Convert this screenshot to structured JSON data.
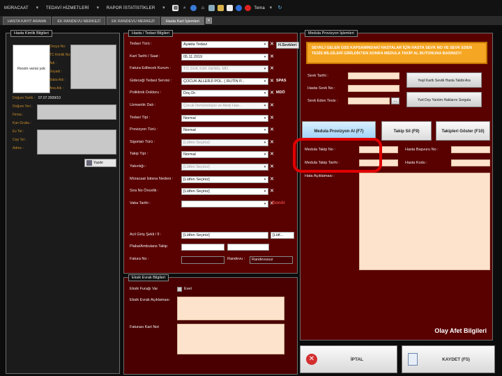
{
  "menu": {
    "items": [
      "MÜRACAAT",
      "TEDAVİ HİZMETLERİ",
      "RAPOR İSTATİSTİKLER"
    ],
    "tema_label": "Tema"
  },
  "tabs": [
    "HASTA KAYIT ARAMA",
    "EK RANDEVU MERKEZİ",
    "EK RANDEVU MERKEZİ",
    "Hasta Kart İşlemleri"
  ],
  "tab_close": "✕",
  "left": {
    "legend": "Hasta Kimlik Bilgileri",
    "photo_text": "Resim verisi yok",
    "labels_top": [
      "Dosya No:",
      "TC Kimlik No:",
      "Adı :",
      "Soyadı :",
      "Baba Adı :",
      "Ana Adı :"
    ],
    "dogum_label": "Doğum Tarihi :",
    "dogum_value": "07.07.2009/10",
    "labels_mid": [
      "Doğum Yeri :",
      "Firma :",
      "Kan Grubu :",
      "Ev Tel :",
      "Cep Tel :",
      "Adres :"
    ],
    "yazdir": "Yazdır"
  },
  "mid": {
    "legend": "Hasta / Tedavi Bilgileri",
    "rows": [
      {
        "label": "Tedavi Türü :",
        "value": "Ayakta Tedavi",
        "extra": "H.Sevkleri"
      },
      {
        "label": "Kart Tarihi / Saat :",
        "value": "05.11.2019"
      },
      {
        "label": "Fatura Edilecek Kurum :",
        "value": "T.C.SGK.SSK GENEL MD."
      },
      {
        "label": "Gideceği Tedavi Servisi :",
        "value": "ÇOCUK ALLERJİ POL. ( RUTİN P...",
        "extra": "SPAS"
      },
      {
        "label": "Poliklinik Doktoru :",
        "value": "Doç.Dr.",
        "extra": "MDÖ"
      },
      {
        "label": "Uzmanlık Dalı :",
        "value": "Çocuk İmmünolojisi ve Alerji Has..."
      },
      {
        "label": "Tedavi Tipi :",
        "value": "Normal"
      },
      {
        "label": "Provizyon Türü :",
        "value": "Normal"
      },
      {
        "label": "Sigortalı Türü :",
        "value": "[Lütfen Seçiniz]"
      },
      {
        "label": "Takip Tipi :",
        "value": "Normal"
      },
      {
        "label": "Yakınlığı :",
        "value": "[Lütfen Seçiniz]"
      },
      {
        "label": "Müracaat İstisna Nedeni :",
        "value": "[Lütfen Seçiniz]"
      },
      {
        "label": "Sıra No Öncelik :",
        "value": "[Lütfen Seçiniz]"
      },
      {
        "label": "Vaka Tarihi :",
        "value": ""
      }
    ],
    "donor": "Donör",
    "acil_label": "Acil Giriş Şekli / İl :",
    "acil_value": "[Lütfen Seçiniz]",
    "acil_value2": "[Lütf...",
    "plaka_label": "Plaka/Ambulans Takip",
    "fatura_label": "Fatura No :",
    "randevu_label": "Randevu :",
    "randevu_value": "Randevusuz"
  },
  "evrak": {
    "legend": "Eksik Evrak Bilgileri",
    "furagi_label": "Eksik Furağı Var",
    "evet": "Evet",
    "aciklama_label": "Eksik Evrak Açıklaması",
    "kart_not_label": "Faturası Kart Not"
  },
  "right": {
    "legend": "Medula Provizyon İşlemleri",
    "banner": "SEVKLİ GELEN GSS KAPSAMINDAKİ HASTALAR İÇİN HASTA SEVK NO VE SEVK EDEN TESİS BİLGİLERİ GİRİLDİKTEN SONRA MEDULA TAKİP AL BUTONUNA BASINIZ!!!",
    "sevk_tarihi": "Sevk Tarihi :",
    "sevk_no": "Hasta Sevk No :",
    "sevk_tesis": "Sevk Eden Tesis :",
    "btn_yesil_kart": "Yeşil Kartlı Sevkli Hasta Takibi Ara",
    "btn_yurtdisi": "Yurt Dışı Yardım Haklarını Sorgula",
    "btn_provizyon": "Medula Provizyon Al (F7)",
    "btn_takip_sil": "Takip Sil (F9)",
    "btn_takipleri": "Takipleri Göster (F10)",
    "takip_no": "Medula Takip No :",
    "basvuru_no": "Hasta Başvuru No :",
    "takip_tarihi": "Medula Takip Tarihi :",
    "hasta_kodu": "Hasta Kodu :",
    "hata_aciklama": "Hata Açıklaması :",
    "afet": "Olay Afet Bilgileri"
  },
  "footer": {
    "iptal": "İPTAL",
    "kaydet": "KAYDET (F5)"
  },
  "colors": {
    "accent_red": "#e00000",
    "panel_bg": "#590000",
    "banner_orange": "#f5a623",
    "input_peach": "#fde3cc"
  }
}
